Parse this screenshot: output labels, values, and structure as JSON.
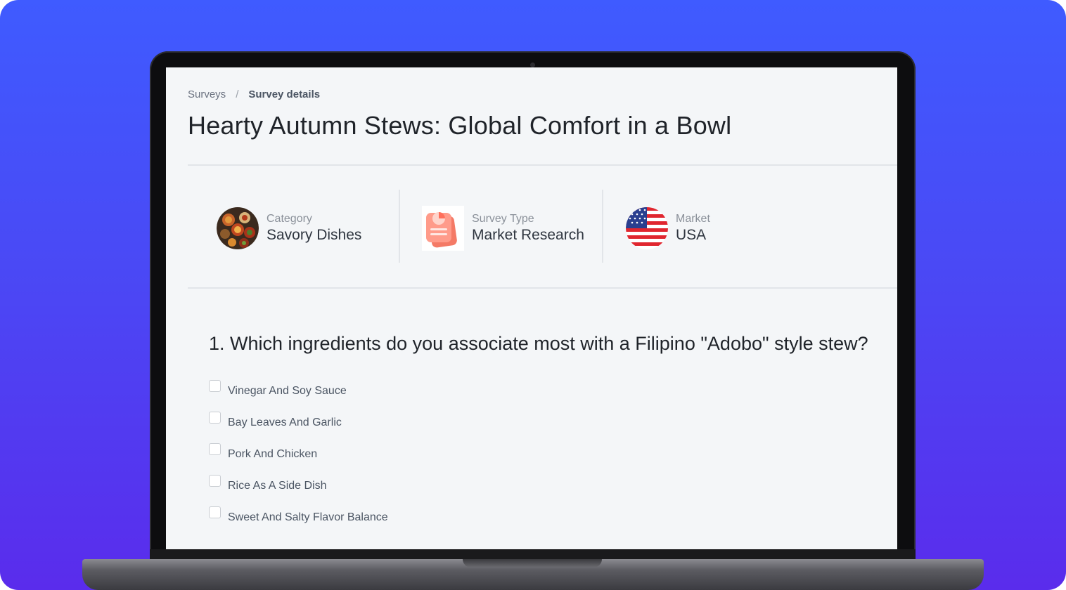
{
  "breadcrumb": {
    "root": "Surveys",
    "separator": "/",
    "current": "Survey details"
  },
  "survey": {
    "title": "Hearty Autumn Stews: Global Comfort in a Bowl",
    "category_label": "Category",
    "category_value": "Savory Dishes",
    "type_label": "Survey Type",
    "type_value": "Market Research",
    "market_label": "Market",
    "market_value": "USA"
  },
  "question": {
    "text": "1. Which ingredients do you associate most with a Filipino \"Adobo\" style stew?",
    "options": [
      "Vinegar And Soy Sauce",
      "Bay Leaves And Garlic",
      "Pork And Chicken",
      "Rice As A Side Dish",
      "Sweet And Salty Flavor Balance"
    ]
  },
  "icons": {
    "category": "food-platter-icon",
    "survey_type": "document-chart-icon",
    "market": "us-flag-icon"
  },
  "colors": {
    "background_top": "#3f5bff",
    "background_bottom": "#5a2cec",
    "screen_bg": "#f4f6f8",
    "doc_icon_accent": "#ff7a6b"
  }
}
